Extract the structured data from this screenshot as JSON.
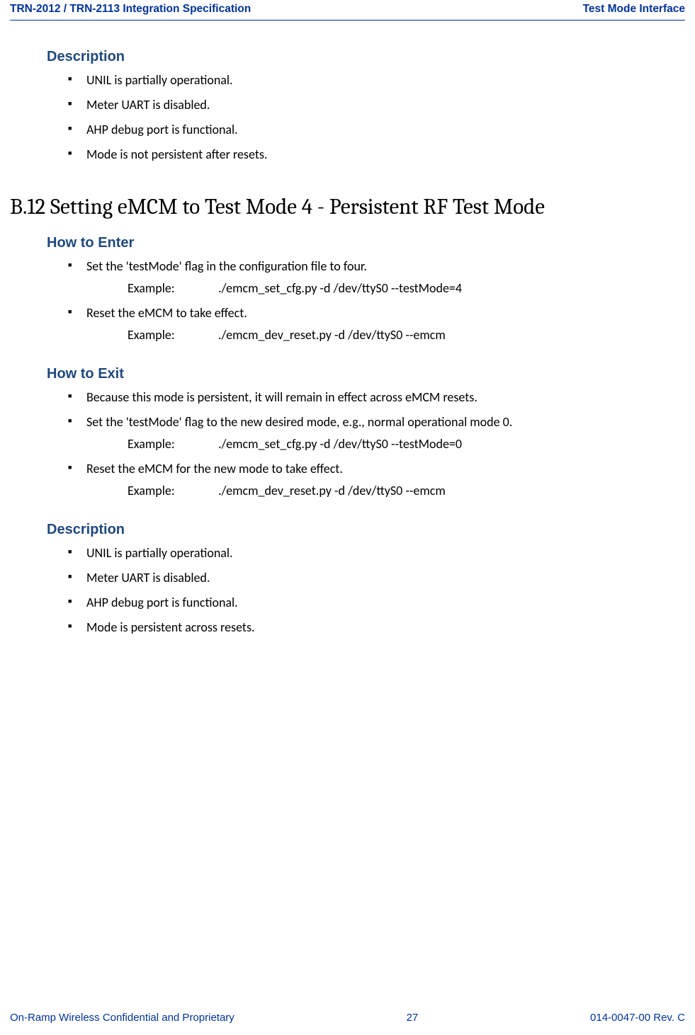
{
  "header": {
    "left": "TRN-2012 / TRN-2113 Integration Specification",
    "right": "Test Mode Interface"
  },
  "footer": {
    "left": "On-Ramp Wireless Confidential and Proprietary",
    "center": "27",
    "right": "014-0047-00 Rev. C"
  },
  "sec1": {
    "title": "Description",
    "items": [
      "UNIL is partially operational.",
      "Meter UART is disabled.",
      "AHP debug port is functional.",
      "Mode is not persistent after resets."
    ]
  },
  "h2": {
    "num": "B.12",
    "title": "Setting eMCM to Test Mode 4 - Persistent RF Test Mode"
  },
  "sec2": {
    "title": "How to Enter",
    "item1": "Set the 'testMode' flag in the configuration file to four.",
    "ex1_label": "Example:",
    "ex1_cmd": "./emcm_set_cfg.py -d /dev/ttyS0 --testMode=4",
    "item2": "Reset the eMCM to take effect.",
    "ex2_label": "Example:",
    "ex2_cmd": "./emcm_dev_reset.py -d /dev/ttyS0 --emcm"
  },
  "sec3": {
    "title": "How to Exit",
    "item1": "Because this mode is persistent, it will remain in effect across eMCM resets.",
    "item2": "Set the 'testMode' flag to the new desired mode, e.g., normal operational mode 0.",
    "ex1_label": "Example:",
    "ex1_cmd": "./emcm_set_cfg.py -d /dev/ttyS0 --testMode=0",
    "item3": "Reset the eMCM for the new mode to take effect.",
    "ex2_label": "Example:",
    "ex2_cmd": "./emcm_dev_reset.py -d /dev/ttyS0 --emcm"
  },
  "sec4": {
    "title": "Description",
    "items": [
      "UNIL is partially operational.",
      "Meter UART is disabled.",
      "AHP debug port is functional.",
      "Mode is persistent across resets."
    ]
  }
}
